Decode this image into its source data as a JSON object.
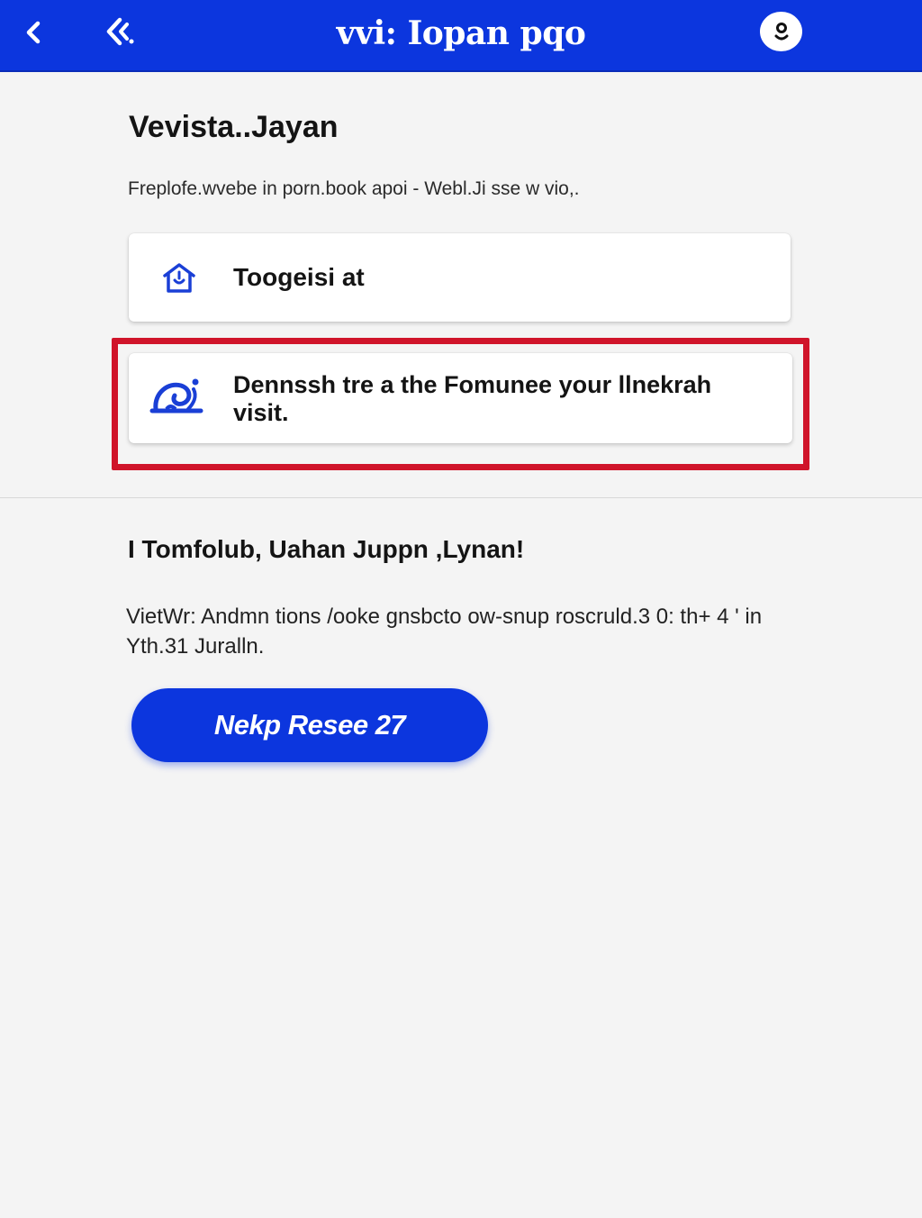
{
  "header": {
    "title": "vvi: Iopan pqo",
    "back_icon": "chevron-left-icon",
    "secondary_back_icon": "double-chevron-left-icon",
    "avatar_icon": "avatar-icon",
    "bg_color": "#0c36de"
  },
  "main": {
    "heading": "Vevista..Jayan",
    "subtext": "Freplofe.wvebe in porn.book apoi - Webl.Ji sse w vio,.",
    "options": [
      {
        "label": "Toogeisi at",
        "icon": "home-icon"
      },
      {
        "label": "Dennssh tre a the Fomunee your llnekrah visit.",
        "icon": "wave-icon",
        "highlighted": true
      }
    ],
    "highlight_color": "#d0142a"
  },
  "section": {
    "heading": "I Tomfolub, Uahan Juppn ,Lynan!",
    "paragraph": "VietWr: Andmn tions /ooke gnsbcto ow-snup roscruld.3 0: th+ 4 ' in Yth.31 Juralln.",
    "cta_label": "Nekp Resee 27",
    "cta_color": "#0c36de"
  }
}
